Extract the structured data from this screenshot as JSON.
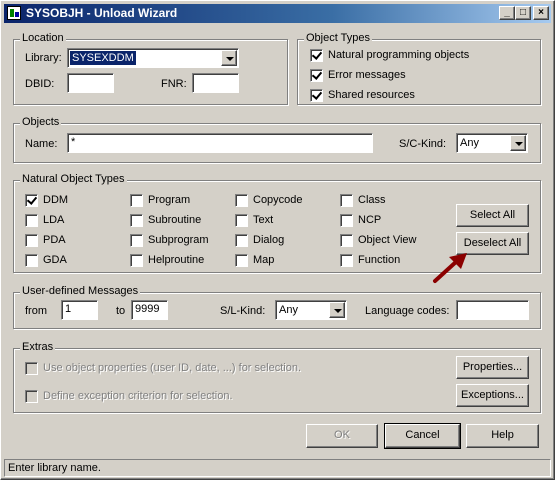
{
  "window": {
    "title": "SYSOBJH - Unload Wizard",
    "controls": {
      "minimize": "_",
      "maximize": "□",
      "close": "×"
    }
  },
  "location": {
    "group_label": "Location",
    "library_label": "Library:",
    "library_value": "SYSEXDDM",
    "dbid_label": "DBID:",
    "dbid_value": "",
    "fnr_label": "FNR:",
    "fnr_value": ""
  },
  "object_types": {
    "group_label": "Object Types",
    "items": [
      {
        "label": "Natural programming objects",
        "checked": true
      },
      {
        "label": "Error messages",
        "checked": true
      },
      {
        "label": "Shared resources",
        "checked": true
      }
    ]
  },
  "objects": {
    "group_label": "Objects",
    "name_label": "Name:",
    "name_value": "*",
    "kind_label": "S/C-Kind:",
    "kind_value": "Any"
  },
  "natural_types": {
    "group_label": "Natural Object Types",
    "columns": [
      [
        {
          "label": "DDM",
          "checked": true
        },
        {
          "label": "LDA",
          "checked": false
        },
        {
          "label": "PDA",
          "checked": false
        },
        {
          "label": "GDA",
          "checked": false
        }
      ],
      [
        {
          "label": "Program",
          "checked": false
        },
        {
          "label": "Subroutine",
          "checked": false
        },
        {
          "label": "Subprogram",
          "checked": false
        },
        {
          "label": "Helproutine",
          "checked": false
        }
      ],
      [
        {
          "label": "Copycode",
          "checked": false
        },
        {
          "label": "Text",
          "checked": false
        },
        {
          "label": "Dialog",
          "checked": false
        },
        {
          "label": "Map",
          "checked": false
        }
      ],
      [
        {
          "label": "Class",
          "checked": false
        },
        {
          "label": "NCP",
          "checked": false
        },
        {
          "label": "Object View",
          "checked": false
        },
        {
          "label": "Function",
          "checked": false
        }
      ]
    ],
    "select_all_label": "Select All",
    "deselect_all_label": "Deselect All"
  },
  "messages": {
    "group_label": "User-defined Messages",
    "from_label": "from",
    "from_value": "1",
    "to_label": "to",
    "to_value": "9999",
    "kind_label": "S/L-Kind:",
    "kind_value": "Any",
    "lang_label": "Language codes:",
    "lang_value": ""
  },
  "extras": {
    "group_label": "Extras",
    "use_props_label": "Use object properties (user ID, date, ...)  for selection.",
    "define_exc_label": "Define exception criterion for selection.",
    "properties_label": "Properties...",
    "exceptions_label": "Exceptions..."
  },
  "footer": {
    "ok_label": "OK",
    "cancel_label": "Cancel",
    "help_label": "Help"
  },
  "status": {
    "text": "Enter library name."
  },
  "colors": {
    "annotation_arrow": "#8b0000",
    "title_bar": "#0a246a"
  }
}
